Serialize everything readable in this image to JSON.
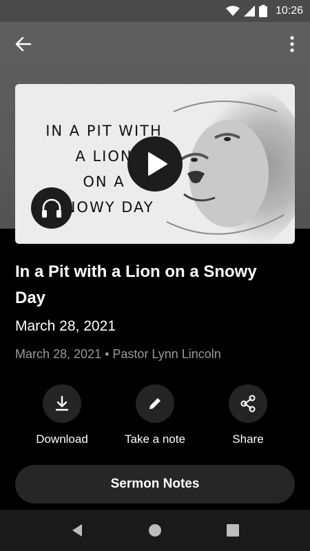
{
  "status_bar": {
    "time": "10:26"
  },
  "app_bar": {
    "back_icon": "arrow-left-icon",
    "menu_icon": "more-vertical-icon"
  },
  "artwork": {
    "text": "IN A PIT WITH\nA LION\nON A\nSNOWY DAY",
    "play_icon": "play-icon",
    "audio_icon": "headphones-icon"
  },
  "sermon": {
    "title": "In a Pit with a Lion on a Snowy Day",
    "date": "March 28, 2021",
    "meta": "March 28, 2021 • Pastor Lynn Lincoln"
  },
  "actions": [
    {
      "label": "Download",
      "icon": "download-icon"
    },
    {
      "label": "Take a note",
      "icon": "pencil-icon"
    },
    {
      "label": "Share",
      "icon": "share-icon"
    }
  ],
  "notes_button": {
    "label": "Sermon Notes"
  },
  "colors": {
    "background": "#000000",
    "header": "#5a5a5a",
    "button": "#262626"
  }
}
